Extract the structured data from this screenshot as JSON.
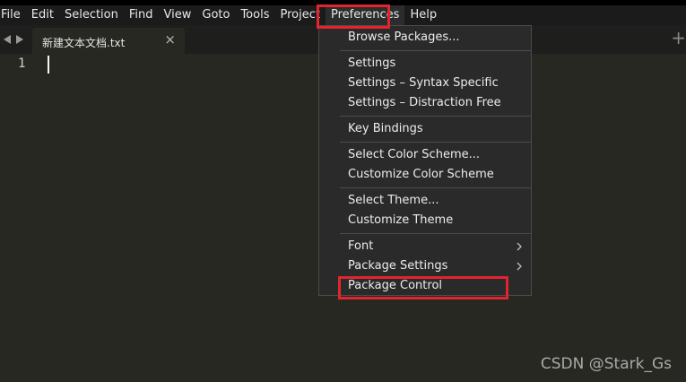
{
  "menubar": {
    "items": [
      "File",
      "Edit",
      "Selection",
      "Find",
      "View",
      "Goto",
      "Tools",
      "Project",
      "Preferences",
      "Help"
    ],
    "active": "Preferences"
  },
  "tab": {
    "filename": "新建文本文档.txt",
    "close_glyph": "×"
  },
  "new_tab_glyph": "+",
  "editor": {
    "line_numbers": [
      "1"
    ]
  },
  "preferences_menu": {
    "groups": [
      [
        "Browse Packages..."
      ],
      [
        "Settings",
        "Settings – Syntax Specific",
        "Settings – Distraction Free"
      ],
      [
        "Key Bindings"
      ],
      [
        "Select Color Scheme...",
        "Customize Color Scheme"
      ],
      [
        "Select Theme...",
        "Customize Theme"
      ],
      [
        "Font",
        "Package Settings",
        "Package Control"
      ]
    ],
    "submenu_items": [
      "Font",
      "Package Settings"
    ],
    "highlighted_item": "Package Control"
  },
  "highlight_color": "#e0252e",
  "watermark": "CSDN @Stark_Gs"
}
